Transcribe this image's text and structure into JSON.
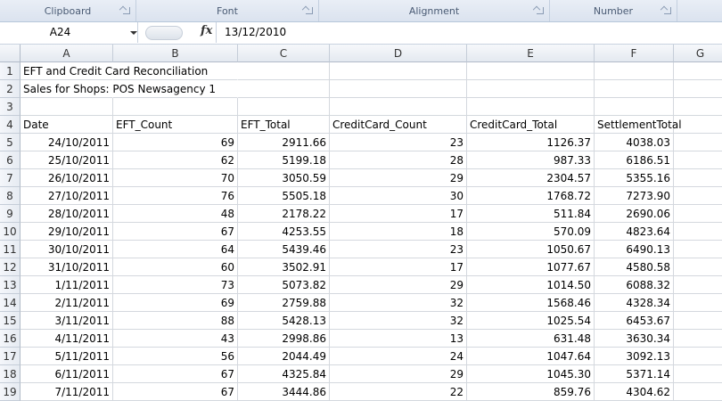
{
  "ribbon": {
    "groups": [
      {
        "label": "Clipboard"
      },
      {
        "label": "Font"
      },
      {
        "label": "Alignment"
      },
      {
        "label": "Number"
      }
    ]
  },
  "formula_bar": {
    "name_box": "A24",
    "fx_label": "fx",
    "content": "13/12/2010"
  },
  "columns": [
    "A",
    "B",
    "C",
    "D",
    "E",
    "F",
    "G"
  ],
  "sheet": {
    "title": "EFT and Credit Card Reconciliation",
    "subtitle": "Sales for Shops: POS Newsagency 1",
    "headers": [
      "Date",
      "EFT_Count",
      "EFT_Total",
      "CreditCard_Count",
      "CreditCard_Total",
      "SettlementTotal"
    ],
    "rows": [
      [
        "24/10/2011",
        "69",
        "2911.66",
        "23",
        "1126.37",
        "4038.03"
      ],
      [
        "25/10/2011",
        "62",
        "5199.18",
        "28",
        "987.33",
        "6186.51"
      ],
      [
        "26/10/2011",
        "70",
        "3050.59",
        "29",
        "2304.57",
        "5355.16"
      ],
      [
        "27/10/2011",
        "76",
        "5505.18",
        "30",
        "1768.72",
        "7273.90"
      ],
      [
        "28/10/2011",
        "48",
        "2178.22",
        "17",
        "511.84",
        "2690.06"
      ],
      [
        "29/10/2011",
        "67",
        "4253.55",
        "18",
        "570.09",
        "4823.64"
      ],
      [
        "30/10/2011",
        "64",
        "5439.46",
        "23",
        "1050.67",
        "6490.13"
      ],
      [
        "31/10/2011",
        "60",
        "3502.91",
        "17",
        "1077.67",
        "4580.58"
      ],
      [
        "1/11/2011",
        "73",
        "5073.82",
        "29",
        "1014.50",
        "6088.32"
      ],
      [
        "2/11/2011",
        "69",
        "2759.88",
        "32",
        "1568.46",
        "4328.34"
      ],
      [
        "3/11/2011",
        "88",
        "5428.13",
        "32",
        "1025.54",
        "6453.67"
      ],
      [
        "4/11/2011",
        "43",
        "2998.86",
        "13",
        "631.48",
        "3630.34"
      ],
      [
        "5/11/2011",
        "56",
        "2044.49",
        "24",
        "1047.64",
        "3092.13"
      ],
      [
        "6/11/2011",
        "67",
        "4325.84",
        "29",
        "1045.30",
        "5371.14"
      ],
      [
        "7/11/2011",
        "67",
        "3444.86",
        "22",
        "859.76",
        "4304.62"
      ]
    ]
  }
}
